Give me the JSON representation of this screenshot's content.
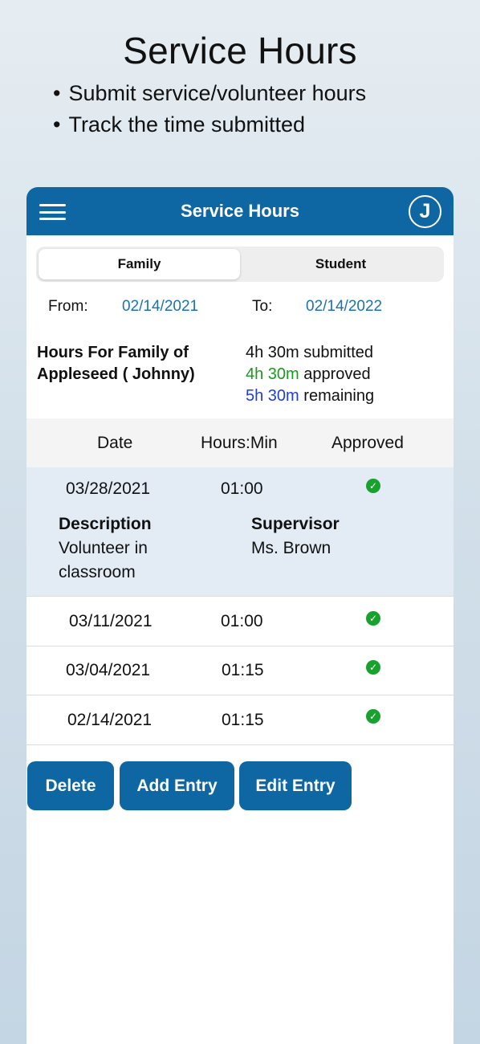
{
  "promo": {
    "title": "Service Hours",
    "bullets": [
      "Submit service/volunteer hours",
      "Track the time submitted"
    ]
  },
  "header": {
    "title": "Service Hours",
    "avatar_letter": "J",
    "menu_icon": "hamburger-icon"
  },
  "tabs": [
    {
      "label": "Family",
      "active": true
    },
    {
      "label": "Student",
      "active": false
    }
  ],
  "date_range": {
    "from_label": "From:",
    "from_value": "02/14/2021",
    "to_label": "To:",
    "to_value": "02/14/2022"
  },
  "summary": {
    "heading": "Hours For Family of Appleseed ( Johnny)",
    "submitted_value": "4h 30m",
    "submitted_text": "submitted",
    "approved_value": "4h 30m",
    "approved_text": "approved",
    "remaining_value": "5h 30m",
    "remaining_text": "remaining"
  },
  "table": {
    "columns": [
      "Date",
      "Hours:Min",
      "Approved"
    ],
    "rows": [
      {
        "date": "03/28/2021",
        "time": "01:00",
        "approved": true,
        "description_label": "Description",
        "description": "Volunteer in classroom",
        "supervisor_label": "Supervisor",
        "supervisor": "Ms. Brown"
      },
      {
        "date": "03/11/2021",
        "time": "01:00",
        "approved": true
      },
      {
        "date": "03/04/2021",
        "time": "01:15",
        "approved": true
      },
      {
        "date": "02/14/2021",
        "time": "01:15",
        "approved": true
      }
    ]
  },
  "actions": {
    "delete": "Delete",
    "add": "Add Entry",
    "edit": "Edit Entry"
  },
  "colors": {
    "primary": "#0e67a3",
    "approved_green": "#1a9a22",
    "remaining_blue": "#1e3fd8",
    "date_link": "#1d72ad"
  }
}
